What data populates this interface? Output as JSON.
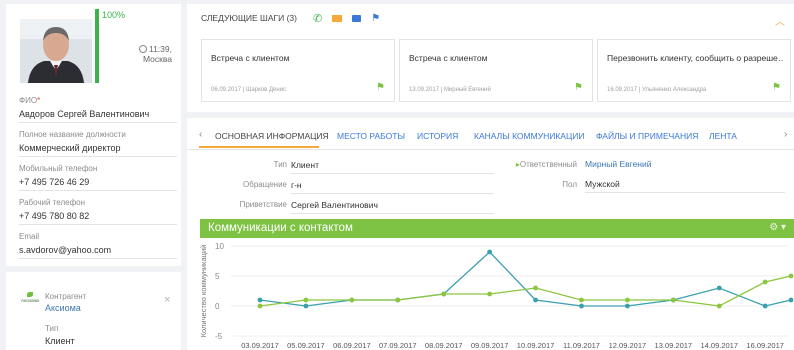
{
  "profile": {
    "progress_label": "100%",
    "progress_value": 1.0,
    "time": "11:39,",
    "city": "Москва",
    "fields": [
      {
        "label": "ФИО",
        "required": true,
        "value": "Авдоров Сергей Валентинович"
      },
      {
        "label": "Полное название должности",
        "required": false,
        "value": "Коммерческий директор"
      },
      {
        "label": "Мобильный телефон",
        "required": false,
        "value": "+7 495 726 46 29"
      },
      {
        "label": "Рабочий телефон",
        "required": false,
        "value": "+7 495 780 80 82"
      },
      {
        "label": "Email",
        "required": false,
        "value": "s.avdorov@yahoo.com"
      }
    ]
  },
  "account": {
    "logo_text": "Аксиома",
    "label": "Контрагент",
    "value": "Аксиома",
    "close": "×",
    "type_label": "Тип",
    "type_value": "Клиент"
  },
  "next_steps": {
    "title": "СЛЕДУЮЩИЕ ШАГИ (3)",
    "icons": [
      "phone-icon",
      "mail-icon",
      "chat-icon",
      "flag-icon"
    ],
    "collapse_glyph": "︿",
    "items": [
      {
        "title": "Встреча с клиентом",
        "date": "06.09.2017",
        "person": "Шарков Денис"
      },
      {
        "title": "Встреча с клиентом",
        "date": "13.09.2017",
        "person": "Мирный Евгений"
      },
      {
        "title": "Перезвонить клиенту, сообщить о разреше…",
        "date": "16.09.2017",
        "person": "Ульяненко Александра"
      }
    ]
  },
  "tabs": {
    "prev": "‹",
    "next": "›",
    "items": [
      "ОСНОВНАЯ ИНФОРМАЦИЯ",
      "МЕСТО РАБОТЫ",
      "ИСТОРИЯ",
      "КАНАЛЫ КОММУНИКАЦИИ",
      "ФАЙЛЫ И ПРИМЕЧАНИЯ",
      "ЛЕНТА"
    ],
    "active_index": 0
  },
  "info": {
    "type_label": "Тип",
    "type_value": "Клиент",
    "salutation_label": "Обращение",
    "salutation_value": "г-н",
    "greeting_label": "Приветствие",
    "greeting_value": "Сергей Валентинович",
    "owner_label": "Ответственный",
    "owner_value": "Мирный Евгений",
    "gender_label": "Пол",
    "gender_value": "Мужской"
  },
  "chart_header": {
    "title": "Коммуникации с контактом",
    "gear": "⚙ ▾"
  },
  "colors": {
    "accent": "#7dc242",
    "link": "#3c78b4",
    "tab_active": "#f3a93b",
    "series_teal": "#3aa0b0",
    "series_green": "#8cc63f"
  },
  "chart_data": {
    "type": "line",
    "x": [
      "03.09.2017",
      "05.09.2017",
      "06.09.2017",
      "07.09.2017",
      "08.09.2017",
      "09.09.2017",
      "10.09.2017",
      "11.09.2017",
      "12.09.2017",
      "13.09.2017",
      "14.09.2017",
      "16.09.2017"
    ],
    "series": [
      {
        "values": [
          1,
          0,
          1,
          1,
          2,
          9,
          1,
          0,
          0,
          1,
          3,
          0,
          1
        ]
      },
      {
        "values": [
          0,
          1,
          1,
          1,
          2,
          2,
          3,
          1,
          1,
          1,
          0,
          4,
          5
        ]
      }
    ],
    "ylabel": "Количество коммуникаций",
    "ylim": [
      -5,
      10
    ],
    "yticks": [
      10,
      5,
      0,
      -5
    ],
    "grid": true
  }
}
